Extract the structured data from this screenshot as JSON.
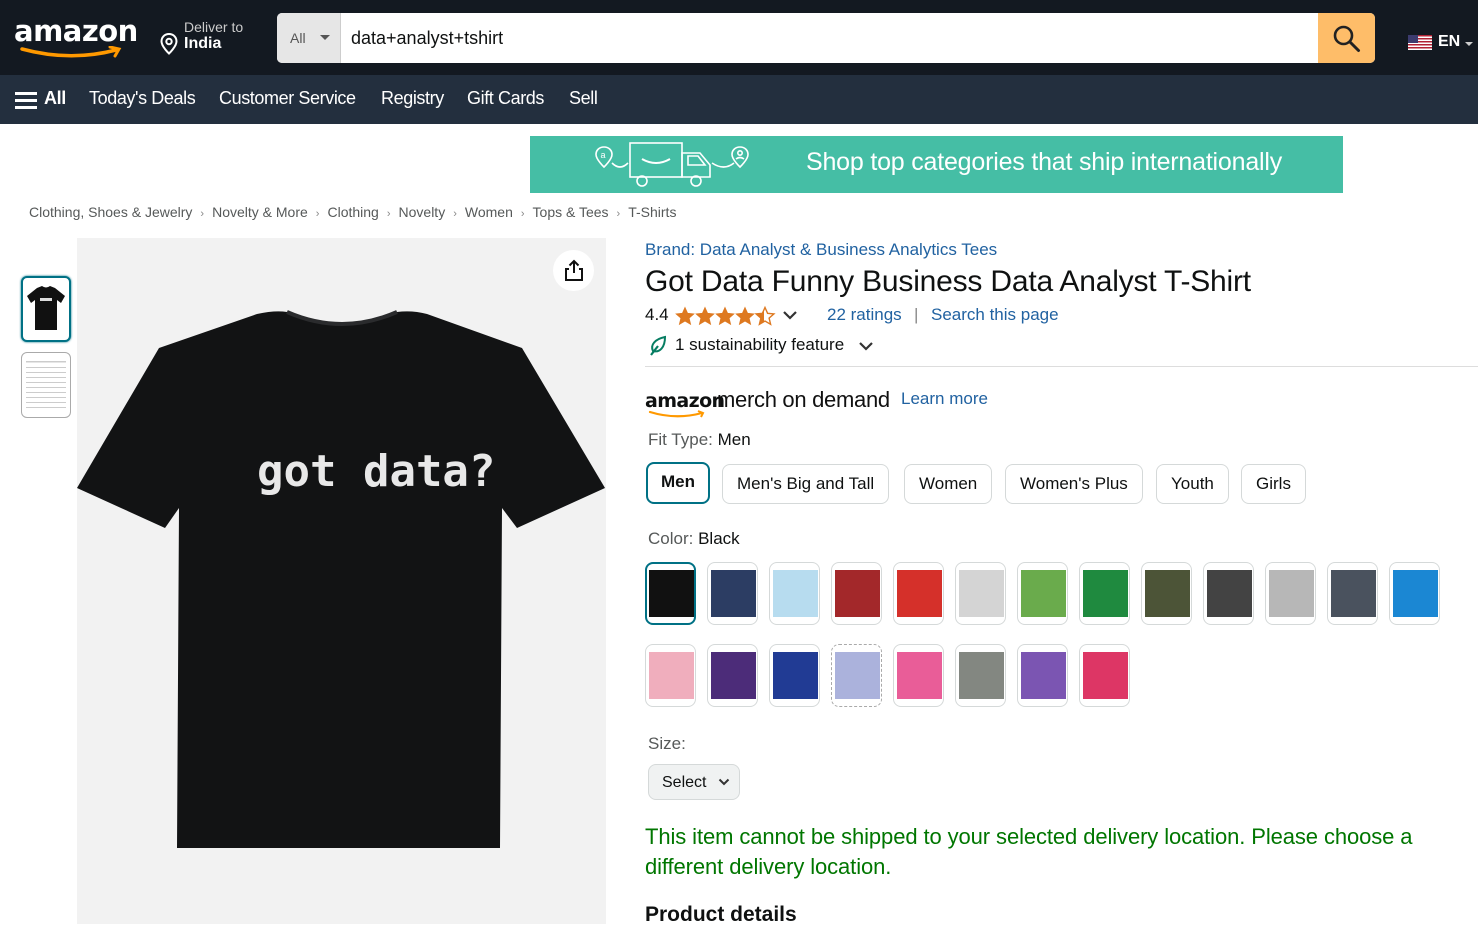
{
  "header": {
    "logo_text": "amazon",
    "deliver_line1": "Deliver to",
    "deliver_line2": "India",
    "search_category": "All",
    "search_query": "data+analyst+tshirt",
    "language": "EN"
  },
  "nav": {
    "all_label": "All",
    "items": [
      "Today's Deals",
      "Customer Service",
      "Registry",
      "Gift Cards",
      "Sell"
    ]
  },
  "banner": {
    "text": "Shop top categories that ship internationally"
  },
  "breadcrumb": [
    "Clothing, Shoes & Jewelry",
    "Novelty & More",
    "Clothing",
    "Novelty",
    "Women",
    "Tops & Tees",
    "T-Shirts"
  ],
  "breadcrumb_sep": "›",
  "product": {
    "brand": "Brand: Data Analyst & Business Analytics Tees",
    "title": "Got Data Funny Business Data Analyst T-Shirt",
    "rating_value": "4.4",
    "rating_stars": 4.4,
    "ratings_count": "22 ratings",
    "separator": "|",
    "search_page": "Search this page",
    "sustainability": "1 sustainability feature",
    "shirt_text": "got data?"
  },
  "merch": {
    "amazon": "amazon",
    "label": "merch on demand",
    "learn_more": "Learn more"
  },
  "fit": {
    "label": "Fit Type:",
    "selected": "Men",
    "options": [
      "Men",
      "Men's Big and Tall",
      "Women",
      "Women's Plus",
      "Youth",
      "Girls"
    ]
  },
  "color": {
    "label": "Color:",
    "selected": "Black",
    "swatches": [
      "#111111",
      "#2c3d63",
      "#b7dcef",
      "#a3282a",
      "#d5302a",
      "#d4d4d4",
      "#6aab4c",
      "#1f8a3f",
      "#4c5437",
      "#434343",
      "#b7b7b7",
      "#4a525e",
      "#1b87d3",
      "#f0aebd",
      "#4c2c79",
      "#213b94",
      "#abb2dc",
      "#e95d98",
      "#838781",
      "#7b55b2",
      "#dd3665"
    ]
  },
  "size": {
    "label": "Size:",
    "select": "Select"
  },
  "shipping_message": "This item cannot be shipped to your selected delivery location. Please choose a different delivery location.",
  "product_details": "Product details",
  "colors": {
    "topbar": "#131921",
    "navbar": "#232f3e",
    "link": "#2162a1",
    "selected": "#007185",
    "success": "#007600",
    "search_button": "#febd69",
    "banner": "#45bea5"
  }
}
